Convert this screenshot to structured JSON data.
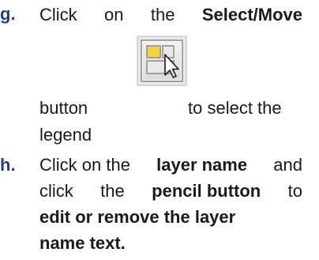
{
  "items": [
    {
      "marker": "g.",
      "l1": {
        "w1": "Click",
        "w2": "on",
        "w3": "the",
        "w4": "Select/Move"
      },
      "l2": {
        "w1": "button",
        "w2": "to select the"
      },
      "l3": "legend",
      "icon_name": "select-move-cursor-icon"
    },
    {
      "marker": "h.",
      "l1": {
        "w1": "Click on the",
        "w2": "layer name",
        "w3": "and"
      },
      "l2": {
        "w1": "click",
        "w2": "the",
        "w3": "pencil button",
        "w4": "to"
      },
      "l3": "edit or remove the layer",
      "l4": "name text."
    }
  ]
}
